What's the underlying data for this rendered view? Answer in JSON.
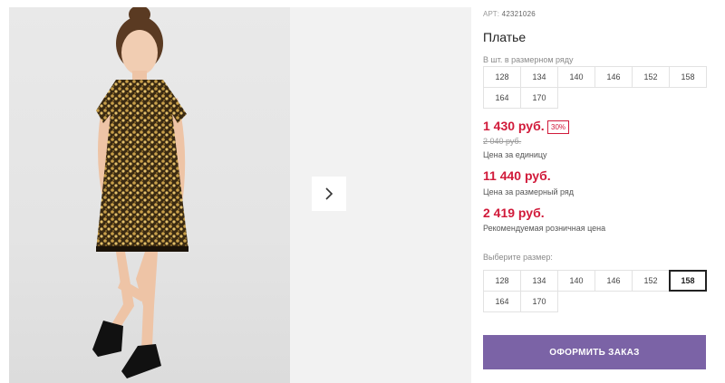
{
  "product": {
    "art_label": "АРТ:",
    "art_number": "42321026",
    "title": "Платье"
  },
  "size_row_hint": "В шт. в размерном ряду",
  "size_row": [
    "128",
    "134",
    "140",
    "146",
    "152",
    "158",
    "164",
    "170"
  ],
  "pricing": {
    "price": "1 430 руб.",
    "discount": "30%",
    "old_price": "2 040 руб.",
    "price_unit_label": "Цена за единицу",
    "row_price": "11 440 руб.",
    "row_price_label": "Цена за размерный ряд",
    "retail_price": "2 419 руб.",
    "retail_price_label": "Рекомендуемая розничная цена"
  },
  "size_select": {
    "label": "Выберите размер:",
    "options": [
      "128",
      "134",
      "140",
      "146",
      "152",
      "158",
      "164",
      "170"
    ],
    "selected": "158"
  },
  "order_button": "ОФОРМИТЬ ЗАКАЗ",
  "colors": {
    "accent": "#7b63a6",
    "price": "#d11a3a"
  },
  "icons": {
    "next": "chevron-right-icon"
  }
}
